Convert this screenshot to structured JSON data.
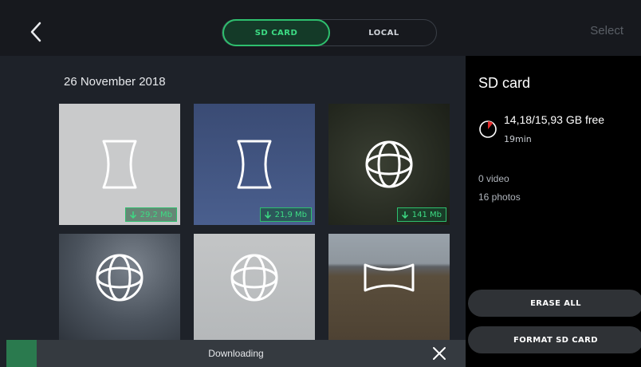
{
  "topbar": {
    "tab_sd": "SD CARD",
    "tab_local": "LOCAL",
    "select_label": "Select",
    "back_icon": "chevron-left-icon"
  },
  "gallery": {
    "date": "26 November 2018",
    "items": [
      {
        "type": "panorama-vertical",
        "size": "29,2 Mb",
        "bg": "#c9cacb"
      },
      {
        "type": "panorama-vertical",
        "size": "21,9 Mb",
        "bg": "#3d4f78"
      },
      {
        "type": "sphere",
        "size": "141 Mb",
        "bg": "#2c3028"
      },
      {
        "type": "sphere",
        "size": "",
        "bg": "#4c5560"
      },
      {
        "type": "sphere",
        "size": "",
        "bg": "#bfc1c2"
      },
      {
        "type": "panorama-horizontal",
        "size": "",
        "bg": "#5e5240"
      }
    ]
  },
  "sidepanel": {
    "title": "SD card",
    "storage_free": "14,18/15,93 GB free",
    "storage_time": "19min",
    "video_count": "0 video",
    "photo_count": "16 photos",
    "erase_label": "ERASE ALL",
    "format_label": "FORMAT SD CARD",
    "storage_icon": "pie-chart-icon",
    "used_fraction": 0.11
  },
  "download": {
    "label": "Downloading",
    "close_icon": "close-icon"
  },
  "colors": {
    "accent": "#3ddc84",
    "background": "#1e2229",
    "panel": "#000000",
    "used": "#e02b2b"
  }
}
